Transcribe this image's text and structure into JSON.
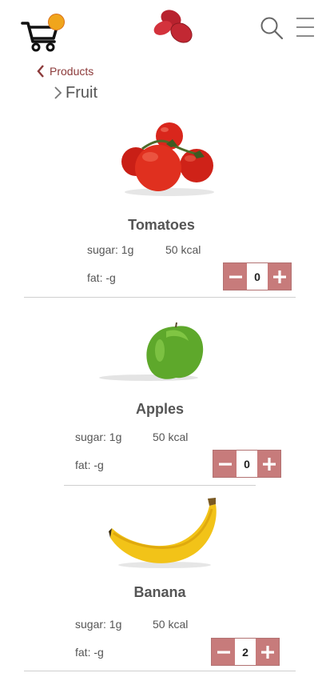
{
  "header": {
    "cart_icon": "shopping-cart-icon",
    "logo_icon": "beans-logo-icon",
    "search_icon": "search-icon",
    "menu_icon": "hamburger-menu-icon"
  },
  "breadcrumb": {
    "back_label": "Products",
    "current_label": "Fruit"
  },
  "products": [
    {
      "name": "Tomatoes",
      "sugar": "sugar: 1g",
      "kcal": "50 kcal",
      "fat": "fat: -g",
      "quantity": "0"
    },
    {
      "name": "Apples",
      "sugar": "sugar: 1g",
      "kcal": "50 kcal",
      "fat": "fat: -g",
      "quantity": "0"
    },
    {
      "name": "Banana",
      "sugar": "sugar: 1g",
      "kcal": "50 kcal",
      "fat": "fat: -g",
      "quantity": "2"
    }
  ],
  "colors": {
    "accent": "#c77b7b",
    "accent_dark": "#8c3a3a",
    "badge": "#f0a51c",
    "logo": "#d3323c"
  }
}
